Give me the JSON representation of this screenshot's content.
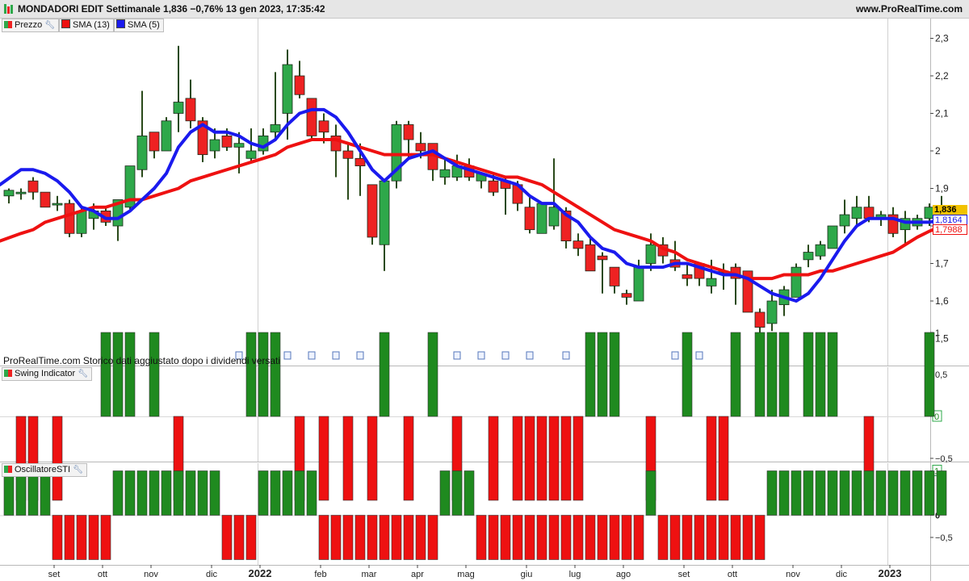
{
  "header": {
    "title": "MONDADORI EDIT Settimanale 1,836 −0,76% 13 gen 2023, 17:35:42",
    "site": "www.ProRealTime.com"
  },
  "legend": {
    "price": "Prezzo",
    "sma13": "SMA (13)",
    "sma5": "SMA (5)",
    "swing": "Swing Indicator",
    "sti": "OscillatoreSTI"
  },
  "note": "ProRealTime.com Storico dati aggiustato dopo i dividendi versati",
  "colors": {
    "up": "#2ea84a",
    "down": "#ee2222",
    "sma13": "#ee1111",
    "sma5": "#1a1aee",
    "green_bar": "#1f8a1f",
    "red_bar": "#ee1111"
  },
  "last_values": {
    "price": "1,836",
    "sma5": "1,8164",
    "sma13": "1,7988"
  },
  "chart_data": {
    "type": "candlestick",
    "price_axis": {
      "ticks": [
        "2,3",
        "2,2",
        "2,1",
        "2",
        "1,9",
        "1,8",
        "1,7",
        "1,6",
        "1,5"
      ],
      "tick_values": [
        2.3,
        2.2,
        2.1,
        2.0,
        1.9,
        1.8,
        1.7,
        1.6,
        1.5
      ]
    },
    "swing_axis": {
      "ticks": [
        "1",
        "0,5",
        "0",
        "−0,5"
      ],
      "tick_values": [
        1,
        0.5,
        0,
        -0.5
      ]
    },
    "sti_axis": {
      "ticks": [
        "1",
        "0",
        "−0,5"
      ],
      "tick_values": [
        1,
        0,
        -0.5
      ]
    },
    "time_axis": {
      "labels": [
        "set",
        "ott",
        "nov",
        "dic",
        "2022",
        "feb",
        "mar",
        "apr",
        "mag",
        "giu",
        "lug",
        "ago",
        "set",
        "ott",
        "nov",
        "dic",
        "2023"
      ],
      "label_bar_index": [
        4,
        8,
        12,
        17,
        21,
        26,
        30,
        34,
        38,
        43,
        47,
        51,
        56,
        60,
        65,
        69,
        73
      ]
    },
    "candles": [
      {
        "o": 1.88,
        "h": 1.9,
        "l": 1.86,
        "c": 1.895
      },
      {
        "o": 1.89,
        "h": 1.9,
        "l": 1.87,
        "c": 1.89
      },
      {
        "o": 1.92,
        "h": 1.93,
        "l": 1.87,
        "c": 1.89
      },
      {
        "o": 1.89,
        "h": 1.89,
        "l": 1.85,
        "c": 1.85
      },
      {
        "o": 1.86,
        "h": 1.88,
        "l": 1.84,
        "c": 1.86
      },
      {
        "o": 1.86,
        "h": 1.87,
        "l": 1.77,
        "c": 1.78
      },
      {
        "o": 1.78,
        "h": 1.85,
        "l": 1.77,
        "c": 1.84
      },
      {
        "o": 1.82,
        "h": 1.86,
        "l": 1.79,
        "c": 1.84
      },
      {
        "o": 1.84,
        "h": 1.85,
        "l": 1.8,
        "c": 1.81
      },
      {
        "o": 1.8,
        "h": 1.87,
        "l": 1.76,
        "c": 1.87
      },
      {
        "o": 1.85,
        "h": 1.96,
        "l": 1.84,
        "c": 1.96
      },
      {
        "o": 1.95,
        "h": 2.16,
        "l": 1.93,
        "c": 2.04
      },
      {
        "o": 2.05,
        "h": 2.05,
        "l": 1.98,
        "c": 2.0
      },
      {
        "o": 2.0,
        "h": 2.09,
        "l": 2.0,
        "c": 2.08
      },
      {
        "o": 2.1,
        "h": 2.28,
        "l": 2.05,
        "c": 2.13
      },
      {
        "o": 2.14,
        "h": 2.19,
        "l": 2.06,
        "c": 2.08
      },
      {
        "o": 2.08,
        "h": 2.09,
        "l": 1.97,
        "c": 1.99
      },
      {
        "o": 2.0,
        "h": 2.06,
        "l": 1.98,
        "c": 2.03
      },
      {
        "o": 2.04,
        "h": 2.06,
        "l": 2.0,
        "c": 2.01
      },
      {
        "o": 2.01,
        "h": 2.05,
        "l": 1.94,
        "c": 2.02
      },
      {
        "o": 1.98,
        "h": 2.06,
        "l": 1.97,
        "c": 2.0
      },
      {
        "o": 2.0,
        "h": 2.06,
        "l": 1.99,
        "c": 2.04
      },
      {
        "o": 2.05,
        "h": 2.21,
        "l": 2.03,
        "c": 2.07
      },
      {
        "o": 2.1,
        "h": 2.27,
        "l": 2.03,
        "c": 2.23
      },
      {
        "o": 2.2,
        "h": 2.24,
        "l": 2.14,
        "c": 2.15
      },
      {
        "o": 2.14,
        "h": 2.14,
        "l": 2.03,
        "c": 2.04
      },
      {
        "o": 2.08,
        "h": 2.1,
        "l": 2.02,
        "c": 2.05
      },
      {
        "o": 2.04,
        "h": 2.07,
        "l": 1.93,
        "c": 2.0
      },
      {
        "o": 2.0,
        "h": 2.02,
        "l": 1.87,
        "c": 1.98
      },
      {
        "o": 1.98,
        "h": 2.02,
        "l": 1.88,
        "c": 1.96
      },
      {
        "o": 1.91,
        "h": 1.91,
        "l": 1.75,
        "c": 1.77
      },
      {
        "o": 1.75,
        "h": 1.92,
        "l": 1.68,
        "c": 1.92
      },
      {
        "o": 1.92,
        "h": 2.08,
        "l": 1.9,
        "c": 2.07
      },
      {
        "o": 2.07,
        "h": 2.08,
        "l": 1.98,
        "c": 2.03
      },
      {
        "o": 2.02,
        "h": 2.05,
        "l": 1.98,
        "c": 2.0
      },
      {
        "o": 2.02,
        "h": 2.02,
        "l": 1.92,
        "c": 1.95
      },
      {
        "o": 1.93,
        "h": 1.98,
        "l": 1.91,
        "c": 1.95
      },
      {
        "o": 1.93,
        "h": 1.99,
        "l": 1.92,
        "c": 1.96
      },
      {
        "o": 1.96,
        "h": 1.98,
        "l": 1.92,
        "c": 1.93
      },
      {
        "o": 1.92,
        "h": 1.94,
        "l": 1.9,
        "c": 1.94
      },
      {
        "o": 1.92,
        "h": 1.94,
        "l": 1.88,
        "c": 1.89
      },
      {
        "o": 1.92,
        "h": 1.93,
        "l": 1.83,
        "c": 1.9
      },
      {
        "o": 1.91,
        "h": 1.92,
        "l": 1.84,
        "c": 1.86
      },
      {
        "o": 1.85,
        "h": 1.88,
        "l": 1.78,
        "c": 1.79
      },
      {
        "o": 1.78,
        "h": 1.86,
        "l": 1.78,
        "c": 1.86
      },
      {
        "o": 1.8,
        "h": 1.98,
        "l": 1.79,
        "c": 1.85
      },
      {
        "o": 1.84,
        "h": 1.85,
        "l": 1.74,
        "c": 1.76
      },
      {
        "o": 1.76,
        "h": 1.78,
        "l": 1.72,
        "c": 1.74
      },
      {
        "o": 1.75,
        "h": 1.77,
        "l": 1.68,
        "c": 1.68
      },
      {
        "o": 1.72,
        "h": 1.73,
        "l": 1.62,
        "c": 1.71
      },
      {
        "o": 1.69,
        "h": 1.69,
        "l": 1.62,
        "c": 1.64
      },
      {
        "o": 1.62,
        "h": 1.63,
        "l": 1.59,
        "c": 1.61
      },
      {
        "o": 1.6,
        "h": 1.71,
        "l": 1.6,
        "c": 1.69
      },
      {
        "o": 1.7,
        "h": 1.78,
        "l": 1.68,
        "c": 1.75
      },
      {
        "o": 1.75,
        "h": 1.77,
        "l": 1.7,
        "c": 1.72
      },
      {
        "o": 1.71,
        "h": 1.76,
        "l": 1.68,
        "c": 1.69
      },
      {
        "o": 1.67,
        "h": 1.7,
        "l": 1.64,
        "c": 1.66
      },
      {
        "o": 1.7,
        "h": 1.7,
        "l": 1.64,
        "c": 1.66
      },
      {
        "o": 1.64,
        "h": 1.71,
        "l": 1.62,
        "c": 1.66
      },
      {
        "o": 1.68,
        "h": 1.7,
        "l": 1.63,
        "c": 1.68
      },
      {
        "o": 1.69,
        "h": 1.7,
        "l": 1.59,
        "c": 1.66
      },
      {
        "o": 1.68,
        "h": 1.68,
        "l": 1.57,
        "c": 1.57
      },
      {
        "o": 1.57,
        "h": 1.58,
        "l": 1.47,
        "c": 1.53
      },
      {
        "o": 1.54,
        "h": 1.63,
        "l": 1.52,
        "c": 1.6
      },
      {
        "o": 1.59,
        "h": 1.64,
        "l": 1.56,
        "c": 1.63
      },
      {
        "o": 1.61,
        "h": 1.7,
        "l": 1.61,
        "c": 1.69
      },
      {
        "o": 1.71,
        "h": 1.75,
        "l": 1.69,
        "c": 1.73
      },
      {
        "o": 1.72,
        "h": 1.76,
        "l": 1.71,
        "c": 1.75
      },
      {
        "o": 1.74,
        "h": 1.8,
        "l": 1.74,
        "c": 1.8
      },
      {
        "o": 1.8,
        "h": 1.87,
        "l": 1.78,
        "c": 1.83
      },
      {
        "o": 1.82,
        "h": 1.88,
        "l": 1.8,
        "c": 1.85
      },
      {
        "o": 1.85,
        "h": 1.88,
        "l": 1.81,
        "c": 1.82
      },
      {
        "o": 1.82,
        "h": 1.84,
        "l": 1.8,
        "c": 1.83
      },
      {
        "o": 1.83,
        "h": 1.85,
        "l": 1.77,
        "c": 1.78
      },
      {
        "o": 1.79,
        "h": 1.84,
        "l": 1.75,
        "c": 1.82
      },
      {
        "o": 1.8,
        "h": 1.83,
        "l": 1.79,
        "c": 1.82
      },
      {
        "o": 1.82,
        "h": 1.86,
        "l": 1.8,
        "c": 1.85
      },
      {
        "o": 1.85,
        "h": 1.88,
        "l": 1.82,
        "c": 1.836
      }
    ],
    "series": [
      {
        "name": "SMA (13)",
        "values": [
          1.76,
          1.78,
          1.79,
          1.81,
          1.82,
          1.83,
          1.84,
          1.85,
          1.85,
          1.86,
          1.87,
          1.87,
          1.88,
          1.89,
          1.9,
          1.92,
          1.93,
          1.94,
          1.95,
          1.96,
          1.97,
          1.98,
          1.99,
          2.01,
          2.02,
          2.03,
          2.03,
          2.03,
          2.02,
          2.01,
          2.0,
          1.99,
          1.99,
          1.99,
          1.99,
          1.99,
          1.98,
          1.97,
          1.96,
          1.95,
          1.94,
          1.93,
          1.93,
          1.92,
          1.91,
          1.89,
          1.87,
          1.85,
          1.83,
          1.81,
          1.79,
          1.78,
          1.77,
          1.76,
          1.74,
          1.73,
          1.71,
          1.7,
          1.69,
          1.68,
          1.67,
          1.66,
          1.66,
          1.66,
          1.67,
          1.67,
          1.67,
          1.68,
          1.68,
          1.69,
          1.7,
          1.71,
          1.72,
          1.73,
          1.75,
          1.77,
          1.786,
          1.7988
        ]
      },
      {
        "name": "SMA (5)",
        "values": [
          1.91,
          1.95,
          1.95,
          1.94,
          1.92,
          1.89,
          1.85,
          1.84,
          1.82,
          1.82,
          1.84,
          1.87,
          1.9,
          1.94,
          2.01,
          2.05,
          2.07,
          2.05,
          2.05,
          2.04,
          2.02,
          2.01,
          2.03,
          2.07,
          2.1,
          2.11,
          2.11,
          2.09,
          2.05,
          2.0,
          1.95,
          1.92,
          1.95,
          1.98,
          1.99,
          2.0,
          1.98,
          1.96,
          1.95,
          1.94,
          1.93,
          1.92,
          1.91,
          1.88,
          1.86,
          1.86,
          1.83,
          1.81,
          1.77,
          1.74,
          1.73,
          1.7,
          1.69,
          1.69,
          1.69,
          1.7,
          1.7,
          1.69,
          1.68,
          1.67,
          1.67,
          1.66,
          1.64,
          1.62,
          1.61,
          1.6,
          1.62,
          1.66,
          1.71,
          1.76,
          1.8,
          1.82,
          1.82,
          1.82,
          1.81,
          1.81,
          1.81,
          1.8164
        ]
      }
    ],
    "swing_values": [
      0,
      -1,
      -1,
      0,
      -1,
      0,
      0,
      0,
      1,
      1,
      1,
      0,
      1,
      0,
      -1,
      0,
      0,
      0,
      0,
      0,
      1,
      1,
      1,
      0,
      -1,
      0,
      -1,
      0,
      -1,
      0,
      -1,
      1,
      0,
      -1,
      0,
      1,
      0,
      -1,
      0,
      0,
      -1,
      0,
      -1,
      -1,
      -1,
      -1,
      -1,
      -1,
      1,
      1,
      1,
      0,
      0,
      -1,
      0,
      0,
      1,
      0,
      -1,
      -1,
      1,
      0,
      1,
      1,
      1,
      0,
      1,
      1,
      1,
      0,
      0,
      -1,
      0,
      0,
      0,
      0,
      1,
      0
    ],
    "sti_values": [
      1,
      1,
      1,
      1,
      -1,
      -1,
      -1,
      -1,
      -1,
      1,
      1,
      1,
      1,
      1,
      1,
      1,
      1,
      1,
      -1,
      -1,
      -1,
      1,
      1,
      1,
      1,
      1,
      -1,
      -1,
      -1,
      -1,
      -1,
      -1,
      -1,
      -1,
      -1,
      -1,
      1,
      1,
      1,
      -1,
      -1,
      -1,
      -1,
      -1,
      -1,
      -1,
      -1,
      -1,
      -1,
      -1,
      -1,
      -1,
      -1,
      1,
      -1,
      -1,
      -1,
      -1,
      -1,
      -1,
      -1,
      -1,
      -1,
      1,
      1,
      1,
      1,
      1,
      1,
      1,
      1,
      1,
      1,
      1,
      1,
      1,
      1,
      1
    ]
  }
}
